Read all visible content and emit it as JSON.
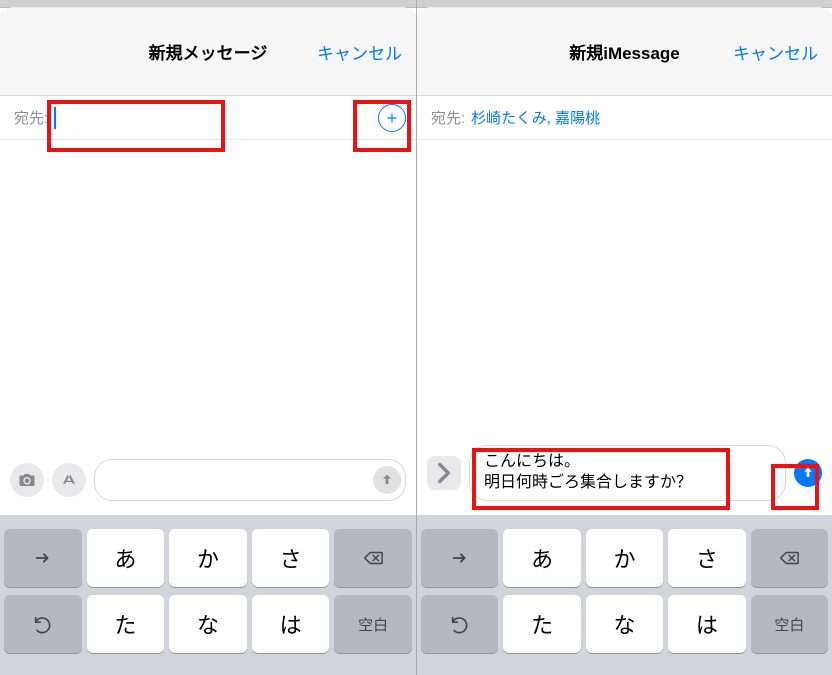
{
  "left": {
    "nav": {
      "title": "新規メッセージ",
      "cancel": "キャンセル"
    },
    "to": {
      "label": "宛先:"
    },
    "keys": {
      "r1": [
        "あ",
        "か",
        "さ"
      ],
      "r2": [
        "た",
        "な",
        "は"
      ],
      "space": "空白"
    }
  },
  "right": {
    "nav": {
      "title": "新規iMessage",
      "cancel": "キャンセル"
    },
    "to": {
      "label": "宛先:",
      "names": "杉崎たくみ, 嘉陽桃"
    },
    "message": "こんにちは。\n明日何時ごろ集合しますか？",
    "keys": {
      "r1": [
        "あ",
        "か",
        "さ"
      ],
      "r2": [
        "た",
        "な",
        "は"
      ],
      "space": "空白"
    }
  }
}
